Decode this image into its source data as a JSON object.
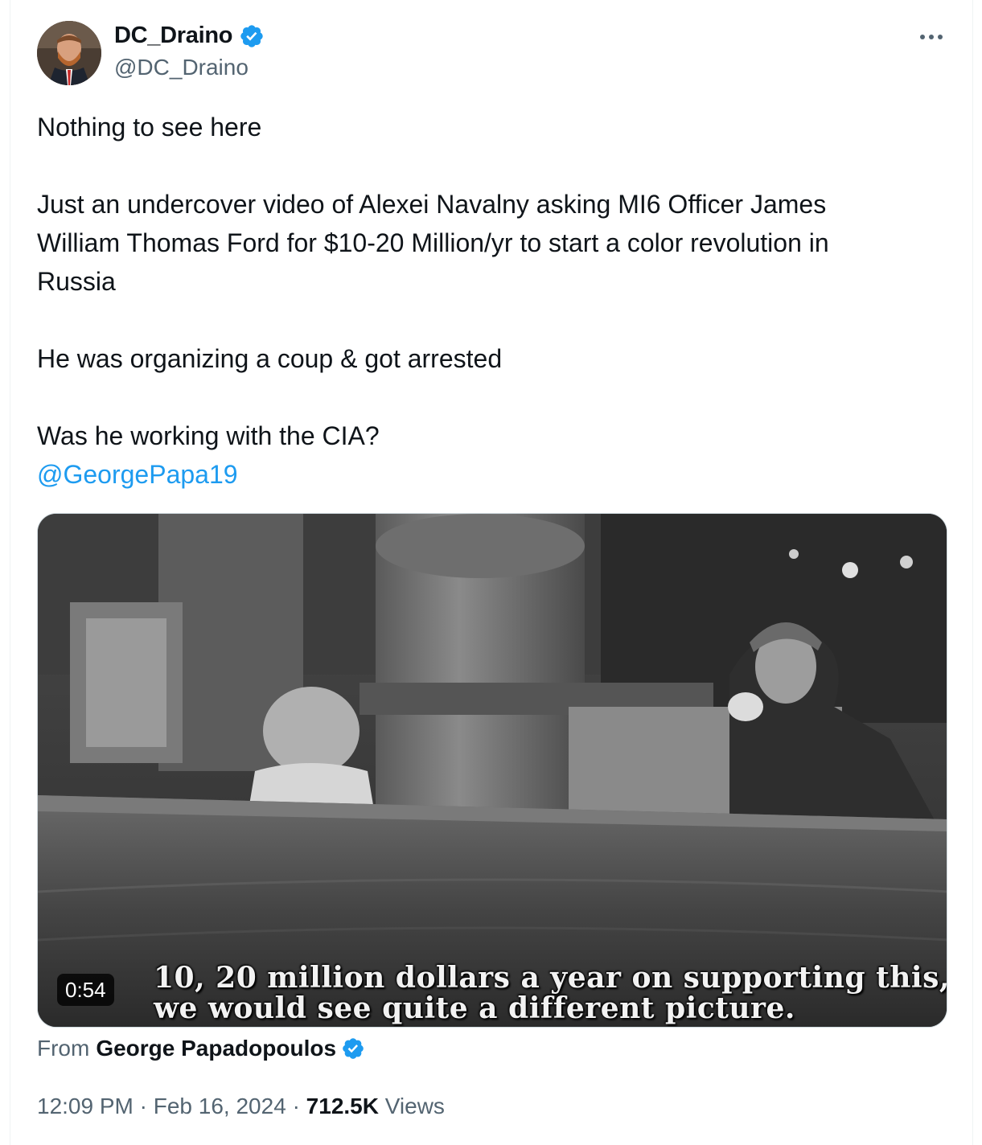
{
  "author": {
    "name": "DC_Draino",
    "handle": "@DC_Draino",
    "verified": true
  },
  "tweet": {
    "line1": "Nothing to see here",
    "para2_line1": "Just an undercover video of Alexei Navalny asking MI6 Officer James",
    "para2_line2": "William Thomas Ford for $10-20 Million/yr to start a color revolution in",
    "para2_line3": "Russia",
    "line3": "He was organizing a coup & got arrested",
    "line4": "Was he working with the CIA?",
    "mention": "@GeorgePapa19"
  },
  "media": {
    "subtitle_line1": "10, 20 million dollars a year on supporting this,",
    "subtitle_line2": "we would see quite a different picture.",
    "duration": "0:54"
  },
  "attribution": {
    "from_label": "From",
    "from_name": "George Papadopoulos",
    "verified": true
  },
  "meta": {
    "time": "12:09 PM",
    "separator": "·",
    "date": "Feb 16, 2024",
    "views_count": "712.5K",
    "views_label": "Views"
  },
  "colors": {
    "link": "#1d9bf0",
    "secondary_text": "#536471",
    "primary_text": "#0f1419",
    "verified_badge": "#1d9bf0"
  }
}
